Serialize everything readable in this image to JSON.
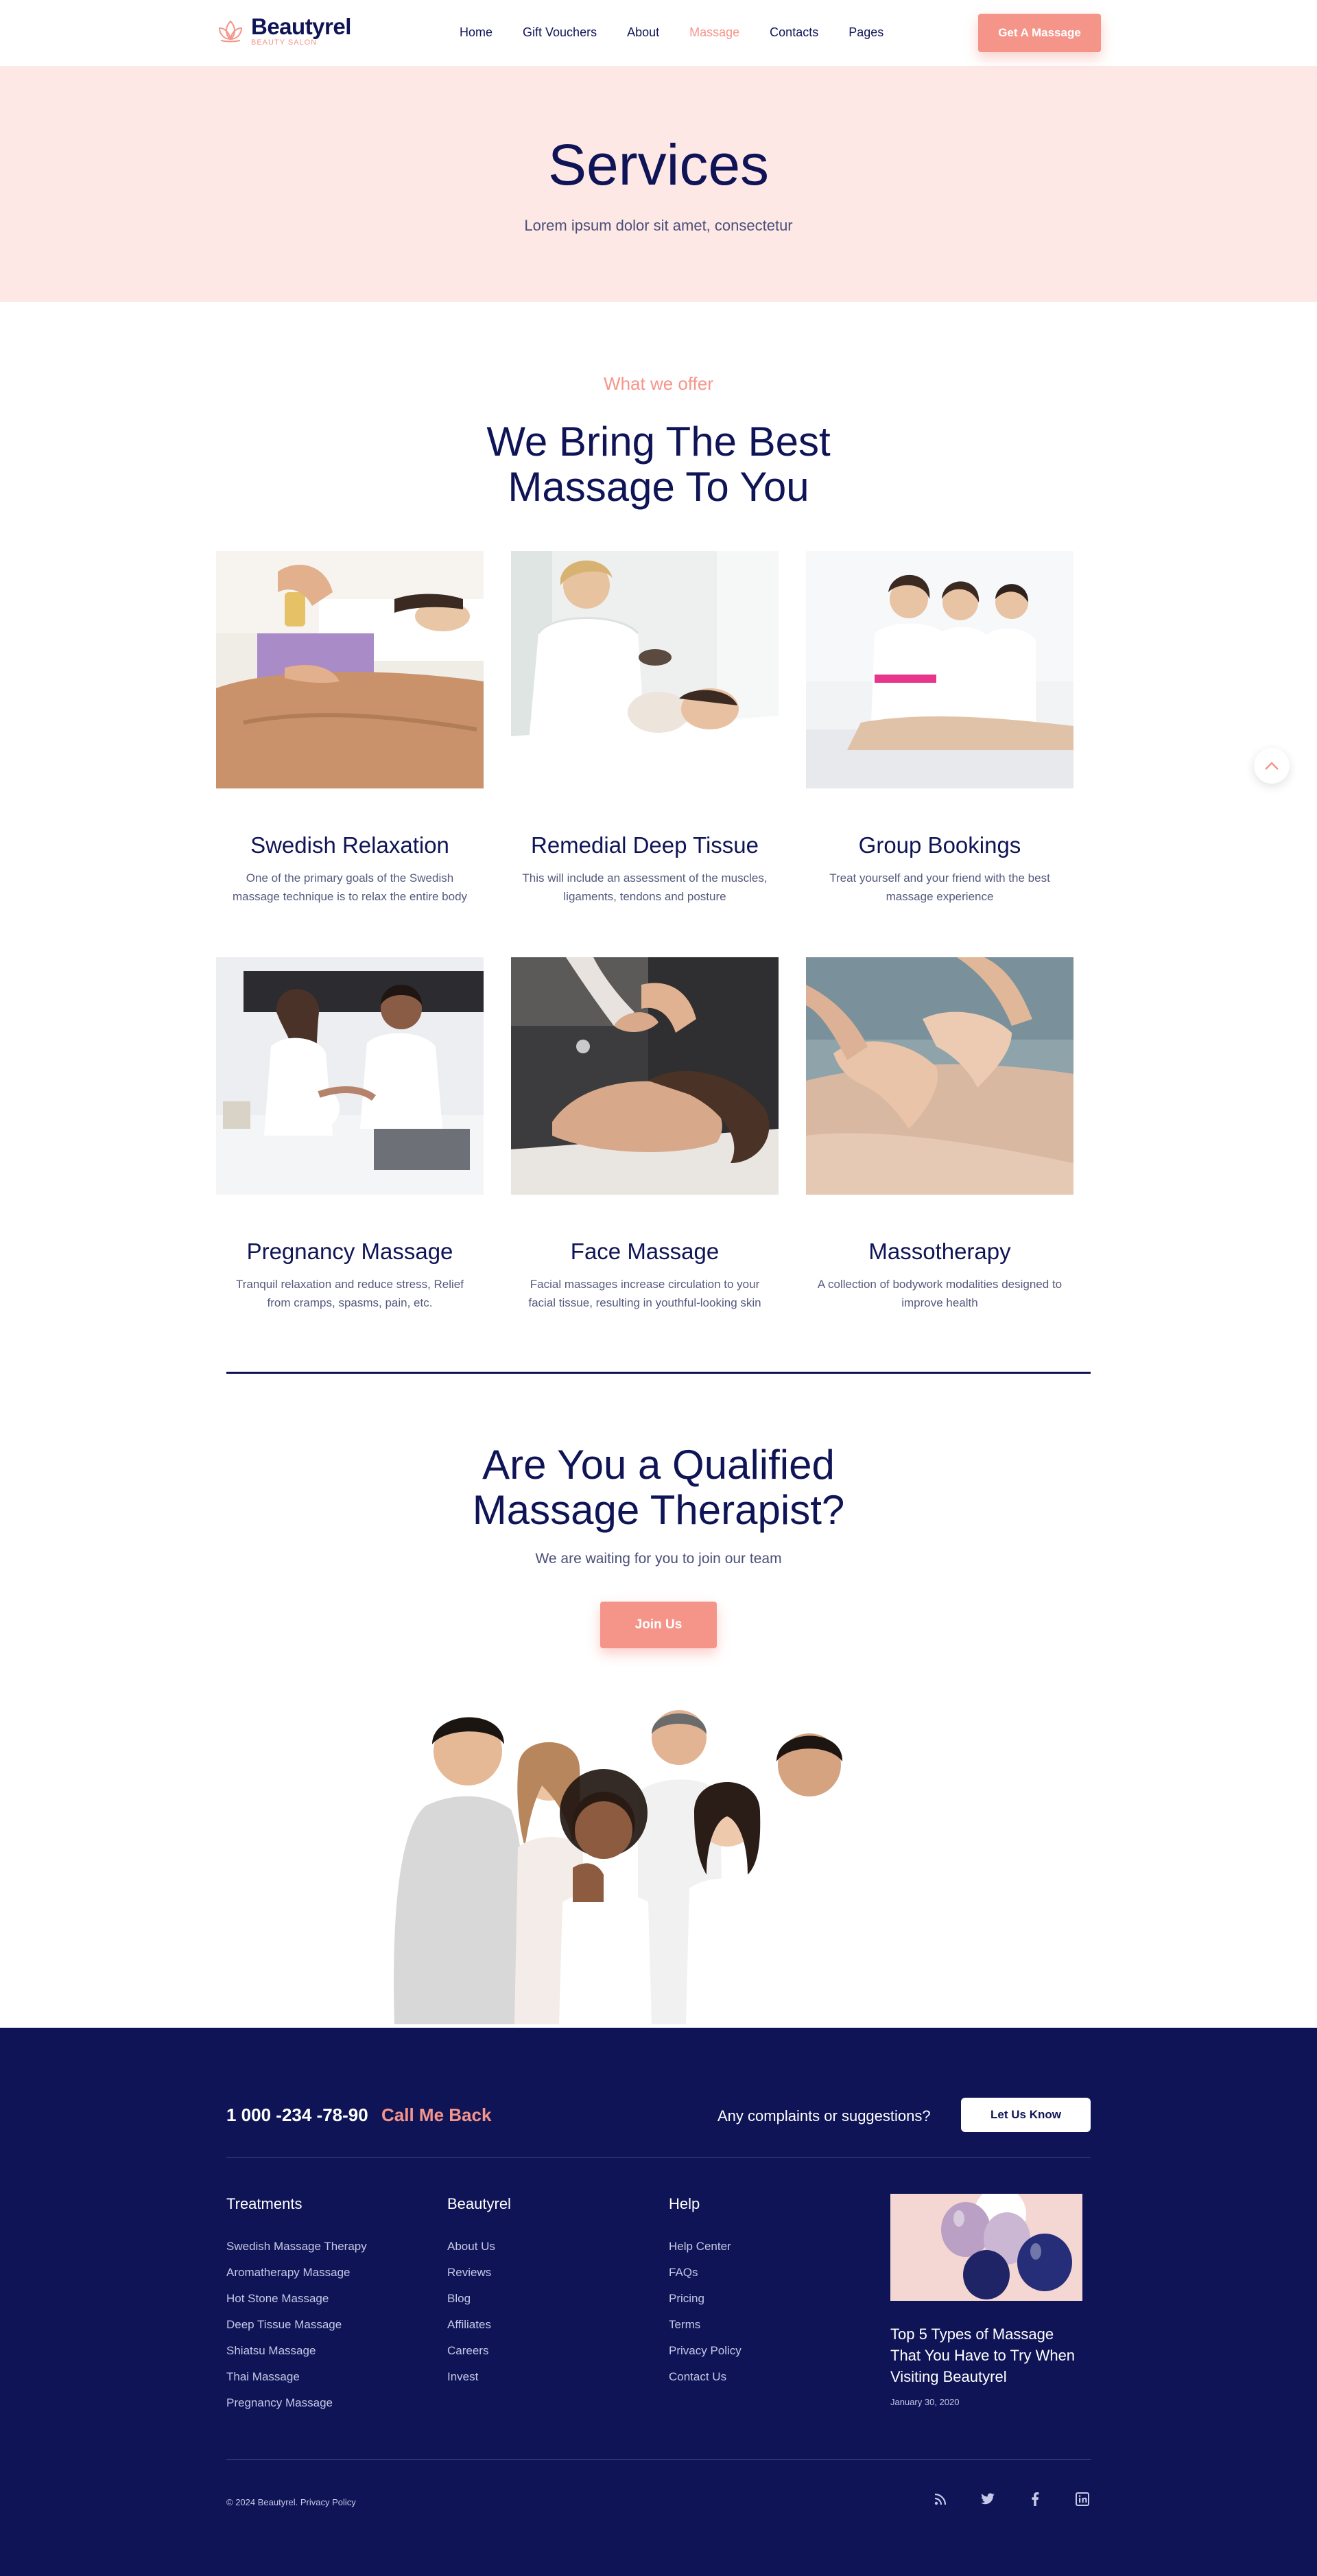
{
  "brand": {
    "name": "Beautyrel",
    "tagline": "BEAUTY SALON",
    "accent": "#f5958a",
    "navy": "#0f1456"
  },
  "nav": {
    "items": [
      {
        "label": "Home"
      },
      {
        "label": "Gift Vouchers"
      },
      {
        "label": "About"
      },
      {
        "label": "Massage",
        "active": true
      },
      {
        "label": "Contacts"
      },
      {
        "label": "Pages"
      }
    ],
    "cta": "Get A Massage"
  },
  "hero": {
    "title": "Services",
    "subtitle": "Lorem ipsum dolor sit amet, consectetur"
  },
  "offer": {
    "eyebrow": "What we offer",
    "title_line1": "We Bring The Best",
    "title_line2": "Massage To You",
    "services": [
      {
        "title": "Swedish Relaxation",
        "desc": "One of the primary goals of the Swedish massage technique is to relax the entire body"
      },
      {
        "title": "Remedial Deep Tissue",
        "desc": "This will include an assessment of the muscles, ligaments, tendons and posture"
      },
      {
        "title": "Group Bookings",
        "desc": "Treat yourself and your friend with the best massage experience"
      },
      {
        "title": "Pregnancy Massage",
        "desc": "Tranquil relaxation and reduce stress, Relief from cramps, spasms, pain, etc."
      },
      {
        "title": "Face Massage",
        "desc": "Facial massages increase circulation to your facial tissue, resulting in youthful-looking skin"
      },
      {
        "title": "Massotherapy",
        "desc": "A collection of bodywork modalities designed to improve health"
      }
    ]
  },
  "therapist": {
    "title_line1": "Are You a Qualified",
    "title_line2": "Massage Therapist?",
    "subtitle": "We are waiting for you to join our team",
    "button": "Join Us"
  },
  "footer": {
    "phone": "1 000 -234 -78-90",
    "call_back": "Call Me Back",
    "complaints": "Any complaints or suggestions?",
    "let_us_know": "Let Us Know",
    "columns": [
      {
        "title": "Treatments",
        "links": [
          "Swedish Massage Therapy",
          "Aromatherapy Massage",
          "Hot Stone Massage",
          "Deep Tissue Massage",
          "Shiatsu Massage",
          "Thai Massage",
          "Pregnancy Massage"
        ]
      },
      {
        "title": "Beautyrel",
        "links": [
          "About Us",
          "Reviews",
          "Blog",
          "Affiliates",
          "Careers",
          "Invest"
        ]
      },
      {
        "title": "Help",
        "links": [
          "Help Center",
          "FAQs",
          "Pricing",
          "Terms",
          "Privacy Policy",
          "Contact Us"
        ]
      }
    ],
    "blog": {
      "title": "Top 5 Types of Massage That You Have to Try When Visiting Beautyrel",
      "date": "January 30, 2020"
    },
    "copyright": "© 2024 Beautyrel. Privacy Policy",
    "socials": [
      "rss-icon",
      "twitter-icon",
      "facebook-icon",
      "linkedin-icon"
    ]
  }
}
